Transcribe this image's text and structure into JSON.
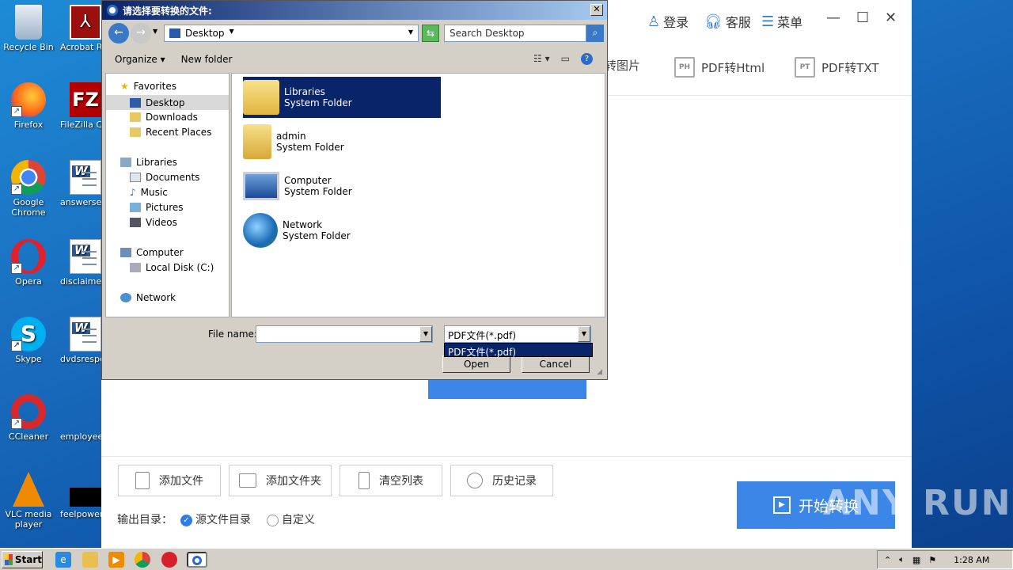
{
  "desktop": {
    "icons_left": [
      {
        "label": "Recycle Bin"
      },
      {
        "label": "Firefox"
      },
      {
        "label": "Google Chrome"
      },
      {
        "label": "Opera"
      },
      {
        "label": "Skype"
      },
      {
        "label": "CCleaner"
      },
      {
        "label": "VLC media player"
      }
    ],
    "icons_right": [
      {
        "label": "Acrobat Reader DC"
      },
      {
        "label": "FileZilla Client"
      },
      {
        "label": "answerse"
      },
      {
        "label": "disclaimer"
      },
      {
        "label": "dvdsrespe"
      },
      {
        "label": "employeep"
      },
      {
        "label": "feelpower"
      }
    ]
  },
  "app": {
    "header": {
      "login": "登录",
      "service": "客服",
      "menu": "菜单"
    },
    "tools": [
      {
        "label": "转图片"
      },
      {
        "label": "PDF转Html",
        "icon_text": "PH"
      },
      {
        "label": "PDF转TXT",
        "icon_text": "PT"
      }
    ],
    "actions": [
      {
        "label": "添加文件"
      },
      {
        "label": "添加文件夹"
      },
      {
        "label": "清空列表"
      },
      {
        "label": "历史记录"
      }
    ],
    "output": {
      "label": "输出目录：",
      "source_option": "源文件目录",
      "custom_option": "自定义",
      "selected": "源文件目录"
    },
    "start_button": "开始转换",
    "watermark": "ANY RUN"
  },
  "dialog": {
    "title": "请选择要转换的文件:",
    "address": "Desktop",
    "search_placeholder": "Search Desktop",
    "toolbar": {
      "organize": "Organize",
      "new_folder": "New folder"
    },
    "nav": {
      "favorites": "Favorites",
      "desktop": "Desktop",
      "downloads": "Downloads",
      "recent": "Recent Places",
      "libraries": "Libraries",
      "documents": "Documents",
      "music": "Music",
      "pictures": "Pictures",
      "videos": "Videos",
      "computer": "Computer",
      "local_disk": "Local Disk (C:)",
      "network": "Network"
    },
    "items": [
      {
        "name": "Libraries",
        "type": "System Folder"
      },
      {
        "name": "admin",
        "type": "System Folder"
      },
      {
        "name": "Computer",
        "type": "System Folder"
      },
      {
        "name": "Network",
        "type": "System Folder"
      }
    ],
    "file_name_label": "File name:",
    "file_name_value": "",
    "file_type": "PDF文件(*.pdf)",
    "file_type_option": "PDF文件(*.pdf)",
    "open": "Open",
    "cancel": "Cancel"
  },
  "taskbar": {
    "start": "Start",
    "time": "1:28 AM"
  }
}
